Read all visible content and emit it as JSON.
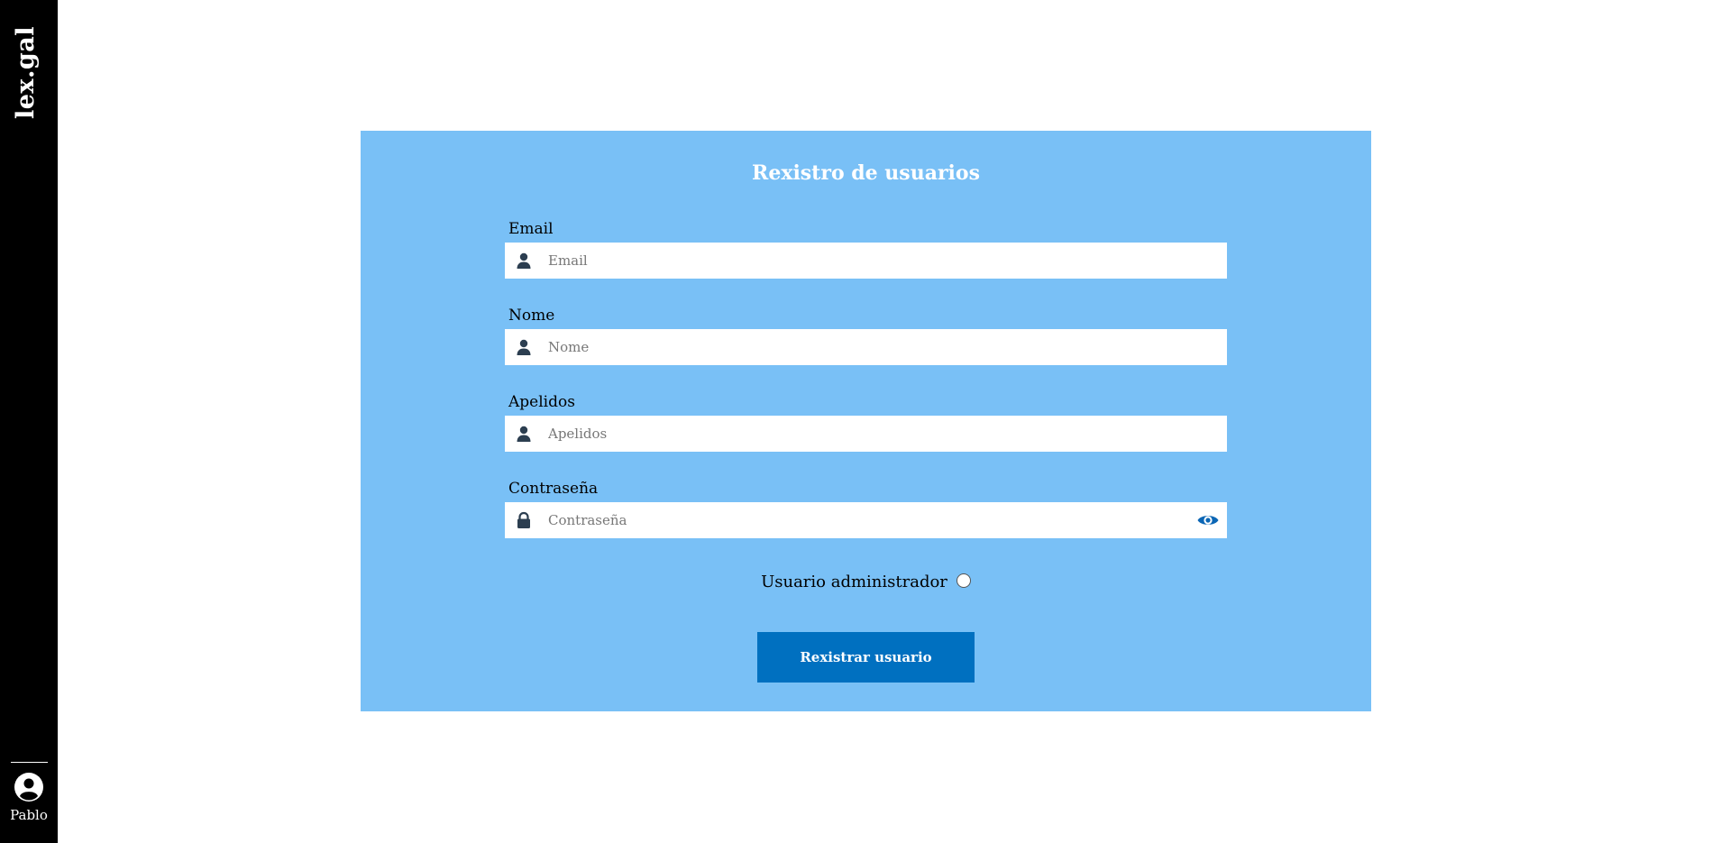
{
  "sidebar": {
    "logo": "lex.gal",
    "user": {
      "name": "Pablo",
      "icon": "user-circle-icon"
    }
  },
  "form": {
    "title": "Rexistro de usuarios",
    "fields": [
      {
        "label": "Email",
        "placeholder": "Email",
        "value": "",
        "icon": "person-icon"
      },
      {
        "label": "Nome",
        "placeholder": "Nome",
        "value": "",
        "icon": "person-icon"
      },
      {
        "label": "Apelidos",
        "placeholder": "Apelidos",
        "value": "",
        "icon": "person-icon"
      },
      {
        "label": "Contraseña",
        "placeholder": "Contraseña",
        "value": "",
        "icon": "lock-icon",
        "trailing_icon": "eye-icon"
      }
    ],
    "admin": {
      "label": "Usuario administrador",
      "checked": false
    },
    "submit_label": "Rexistrar usuario"
  },
  "colors": {
    "sidebar_bg": "#000000",
    "panel_bg": "#79c0f6",
    "button_bg": "#0070c0",
    "icon_dark": "#2c3e50",
    "eye_icon": "#0b66b5"
  }
}
